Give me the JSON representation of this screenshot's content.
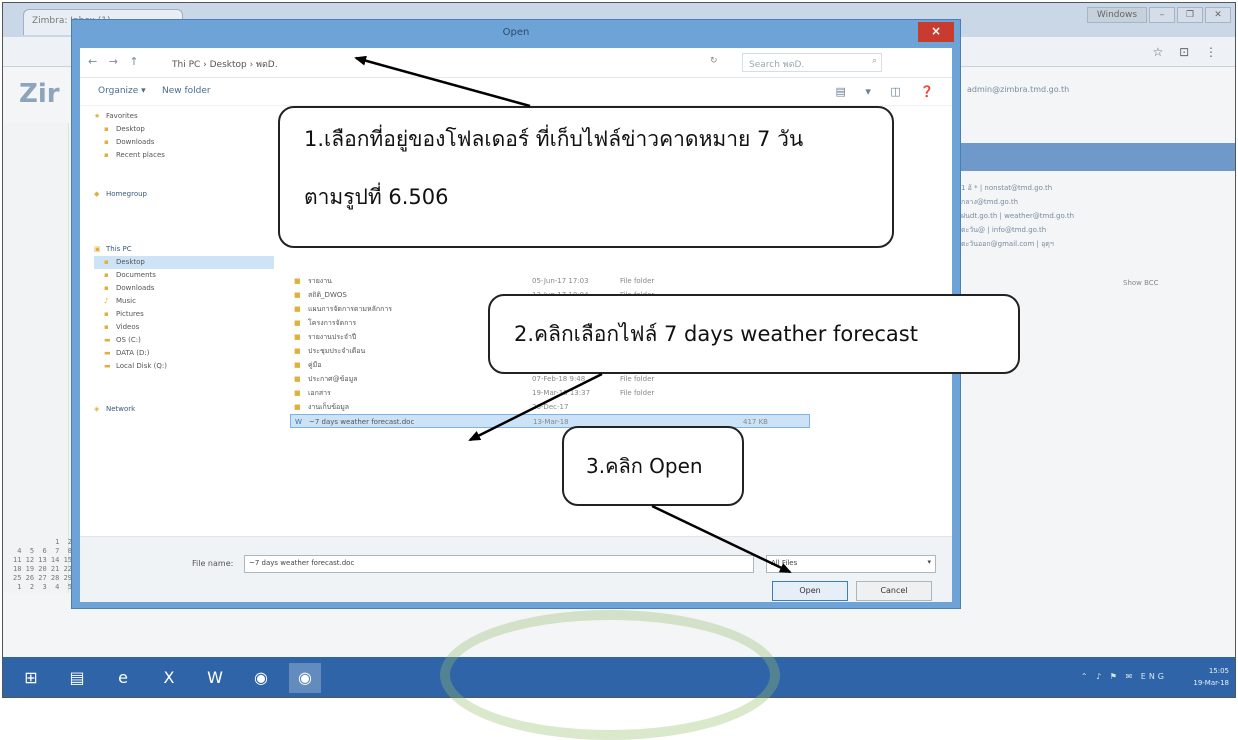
{
  "dialog": {
    "title": "Open",
    "close_glyph": "×",
    "breadcrumb": "Thi PC › Desktop › พดD.",
    "nav_glyphs": "← → ↑",
    "refresh_glyph": "↻",
    "search_placeholder": "Search พดD.",
    "search_glyph": "⌕",
    "organize_label": "Organize ▾",
    "new_folder_label": "New folder",
    "view_glyphs": "▤ ▾ ◫ ❓",
    "sidebar": {
      "favorites": {
        "label": "Favorites",
        "items": [
          "Desktop",
          "Downloads",
          "Recent places"
        ]
      },
      "homegroup": "Homegroup",
      "thispc": {
        "label": "This PC",
        "items": [
          "Desktop",
          "Documents",
          "Downloads",
          "Music",
          "Pictures",
          "Videos",
          "OS (C:)",
          "DATA (D:)",
          "Local Disk (Q:)"
        ]
      },
      "network": "Network"
    },
    "files": [
      {
        "name": "รายงาน",
        "date": "05-Jun-17 17:03",
        "type": "File folder",
        "size": ""
      },
      {
        "name": "สถิติ_DWOS",
        "date": "13-Jun-17 18:04",
        "type": "File folder",
        "size": ""
      },
      {
        "name": "แผนการจัดการตามหลักการ",
        "date": "",
        "type": "",
        "size": ""
      },
      {
        "name": "โครงการจัดการ",
        "date": "",
        "type": "",
        "size": ""
      },
      {
        "name": "รายงานประจำปี",
        "date": "",
        "type": "",
        "size": ""
      },
      {
        "name": "ประชุมประจำเดือน",
        "date": "",
        "type": "",
        "size": ""
      },
      {
        "name": "คู่มือ",
        "date": "",
        "type": "",
        "size": ""
      },
      {
        "name": "ประกาศ@ข้อมูล",
        "date": "07-Feb-18 9:48",
        "type": "File folder",
        "size": ""
      },
      {
        "name": "เอกสาร",
        "date": "19-Mar-18 13:37",
        "type": "File folder",
        "size": ""
      },
      {
        "name": "งานเก็บข้อมูล",
        "date": "26-Dec-17",
        "type": "",
        "size": ""
      },
      {
        "name": "~7 days weather forecast.doc",
        "date": "13-Mar-18",
        "type": "",
        "size": "417 KB"
      }
    ],
    "file_name_label": "File name:",
    "file_name_value": "~7 days weather forecast.doc",
    "file_type_value": "All Files",
    "file_type_caret": "▾",
    "open_label": "Open",
    "cancel_label": "Cancel"
  },
  "browser": {
    "tab_title": "Zimbra: Inbox (1)",
    "brand": "Zir",
    "user_text": "admin@zimbra.tmd.go.th",
    "window_controls": [
      "Windows",
      "–",
      "❐",
      "✕"
    ],
    "toolbar_icons": "☆ ⊡ ⋮",
    "contacts": [
      "1 อ้ * | nonstat@tmd.go.th",
      "กลาง@tmd.go.th",
      "ฝนdt.go.th | weather@tmd.go.th",
      "ตะวัน@ | info@tmd.go.th",
      "ตะวันออก@gmail.com | อุตุฯ"
    ],
    "contact_more": "Show BCC",
    "calendar": "          1  2  3\n 4  5  6  7  8  9 10\n11 12 13 14 15 16 17\n18 19 20 21 22 23 24\n25 26 27 28 29 30 31\n 1  2  3  4  5  6  7"
  },
  "annotations": {
    "step1_line1": "1.เลือกที่อยู่ของโฟลเดอร์ ที่เก็บไฟล์ข่าวคาดหมาย 7 วัน",
    "step1_line2": "ตามรูปที่ 6.506",
    "step2": "2.คลิกเลือกไฟล์  7 days  weather  forecast",
    "step3": "3.คลิก Open"
  },
  "taskbar": {
    "tray": "⌃ ♪ ⚑ ✉ ENG",
    "clock_time": "15:05",
    "clock_date": "19-Mar-18"
  }
}
